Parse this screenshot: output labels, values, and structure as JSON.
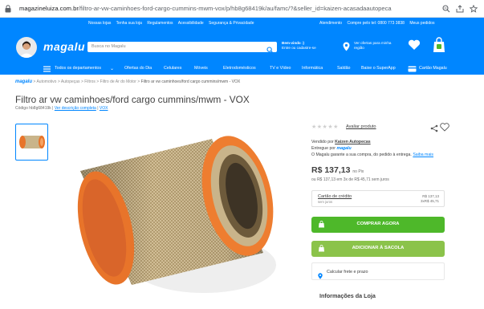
{
  "browser": {
    "url_domain": "magazineluiza.com.br",
    "url_path": "/filtro-ar-vw-caminhoes-ford-cargo-cummins-mwm-vox/p/hb8g68419k/au/famc/?&seller_id=kaizen-acasadaautopeca"
  },
  "header": {
    "links": [
      "Nossas lojas",
      "Tenha sua loja",
      "Regulamentos",
      "Acessibilidade",
      "Segurança & Privacidade"
    ],
    "right_links": [
      "Atendimento",
      "Compre pelo tel: 0800 773 3838",
      "Meus pedidos"
    ],
    "logo": "magalu",
    "search_placeholder": "Busca no Magalu",
    "welcome_line1": "Bem-vindo :)",
    "welcome_line2": "Entre ou cadastre-se",
    "offers_line1": "Ver ofertas para minha",
    "offers_line2": "região"
  },
  "nav": {
    "items": [
      "Todos os departamentos",
      "Ofertas do Dia",
      "Celulares",
      "Móveis",
      "Eletrodomésticos",
      "TV e Vídeo",
      "Informática",
      "Saldão",
      "Baixe o SuperApp",
      "Cartão Magalu"
    ]
  },
  "breadcrumb": {
    "logo": "magalu",
    "items": [
      "Automotivo",
      "Autopeças",
      "Filtros",
      "Filtro de Ar do Motor"
    ],
    "current": "Filtro ar vw caminhoes/ford cargo cummins/mwm - VOX"
  },
  "product": {
    "title": "Filtro ar vw caminhoes/ford cargo cummins/mwm - VOX",
    "code": "Código hb8g68419k |",
    "desc_link": "Ver descrição completa",
    "desc_sep": "|",
    "vox_link": "VOX",
    "stars": "★★★★★",
    "rate_link": "Avaliar produto",
    "sold_by_label": "Vendido por",
    "seller": "Kaizen Autopecas",
    "delivered_by_label": "Entregue por",
    "delivered_by": "magalu",
    "guarantee": "O Magalu garante a sua compra, do pedido à entrega.",
    "guarantee_link": "Saiba mais",
    "price": "R$ 137,13",
    "price_suffix": "no Pix",
    "installments": "ou R$ 137,13 em 3x de R$ 45,71 sem juros",
    "card_label": "Cartão de crédito",
    "card_sub": "sem juros",
    "card_total": "R$ 137,13",
    "card_inst": "3xR$ 45,71",
    "buy_button": "COMPRAR AGORA",
    "cart_button": "ADICIONAR À SACOLA",
    "shipping": "Calcular frete e prazo",
    "store_info": "Informações da Loja"
  },
  "colors": {
    "brand": "#0086ff",
    "buy": "#4eb82a",
    "cart": "#8bc34a",
    "filter": "#e8742a"
  }
}
